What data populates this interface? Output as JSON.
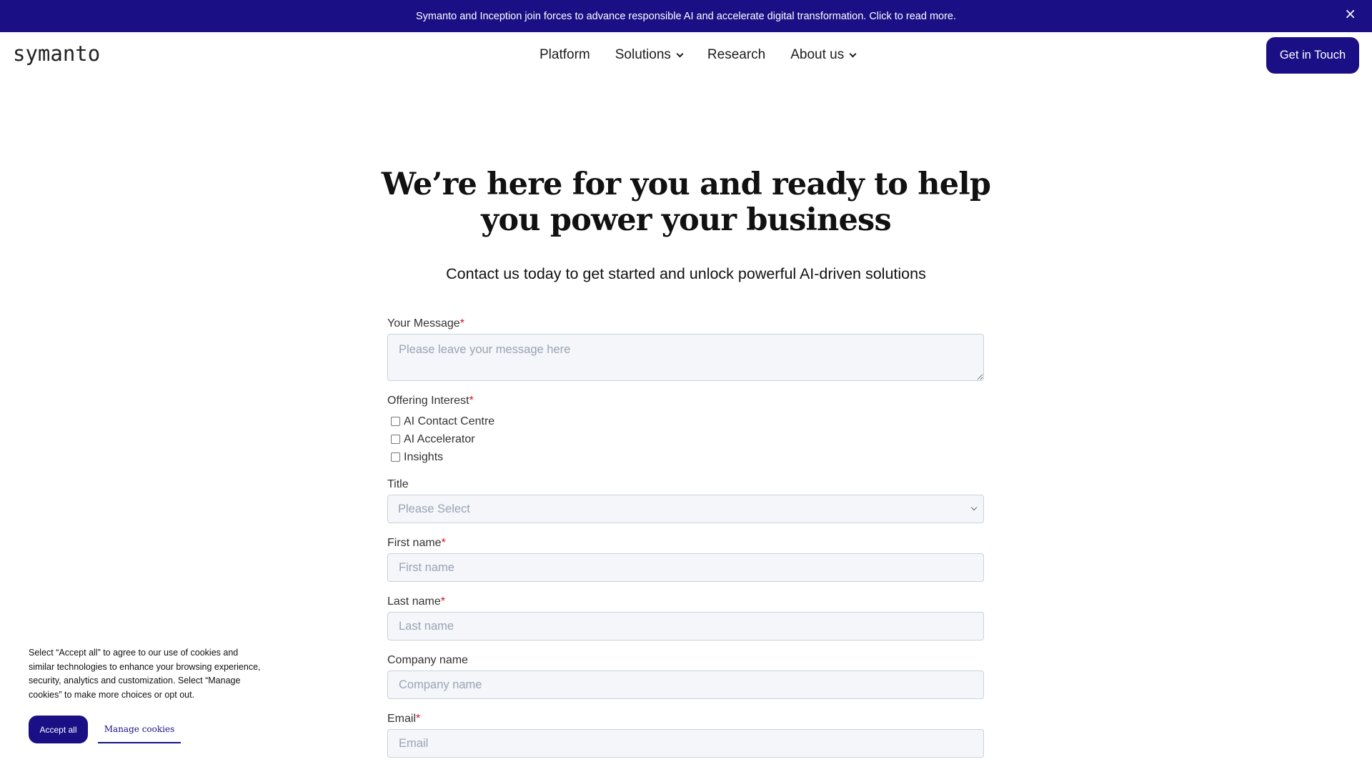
{
  "banner": {
    "text": "Symanto and Inception join forces to advance responsible AI and accelerate digital transformation. Click to read more.",
    "close_glyph": "×"
  },
  "header": {
    "logo": "symanto",
    "nav": [
      {
        "label": "Platform",
        "has_dropdown": false
      },
      {
        "label": "Solutions",
        "has_dropdown": true
      },
      {
        "label": "Research",
        "has_dropdown": false
      },
      {
        "label": "About us",
        "has_dropdown": true
      }
    ],
    "cta_label": "Get in Touch"
  },
  "hero": {
    "title": "We’re here for you and ready to help you power your business",
    "subtitle": "Contact us today to get started and unlock powerful AI-driven solutions"
  },
  "form": {
    "required_mark": "*",
    "message": {
      "label": "Your Message",
      "placeholder": "Please leave your message here"
    },
    "offering": {
      "label": "Offering Interest",
      "options": [
        "AI Contact Centre",
        "AI Accelerator",
        "Insights"
      ]
    },
    "title": {
      "label": "Title",
      "selected": "Please Select"
    },
    "first_name": {
      "label": "First name",
      "placeholder": "First name"
    },
    "last_name": {
      "label": "Last name",
      "placeholder": "Last name"
    },
    "company": {
      "label": "Company name",
      "placeholder": "Company name"
    },
    "email": {
      "label": "Email",
      "placeholder": "Email"
    }
  },
  "cookie": {
    "text": "Select “Accept all” to agree to our use of cookies and similar technologies to enhance your browsing experience, security, analytics and customization. Select “Manage cookies” to make more choices or opt out.",
    "accept_label": "Accept all",
    "manage_label": "Manage cookies"
  },
  "colors": {
    "brand": "#1a0f85",
    "required": "#d0102b",
    "field_bg": "#f4f6fa"
  }
}
